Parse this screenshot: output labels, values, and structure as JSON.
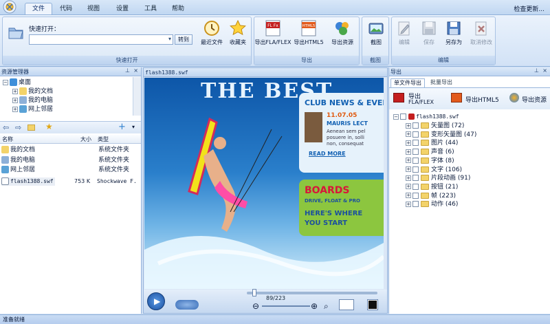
{
  "tabs": [
    "文件",
    "代码",
    "视图",
    "设置",
    "工具",
    "帮助"
  ],
  "check_update": "检查更新...",
  "ribbon": {
    "quick_open": {
      "label": "快速打开：",
      "button": "转到",
      "group": "快速打开"
    },
    "recent": "最近文件",
    "favorites": "收藏夹",
    "export_group": "导出",
    "export_fla": "导出FLA/FLEX",
    "export_html5": "导出HTML5",
    "export_res": "导出资源",
    "capture": "截图",
    "capture_group": "截图",
    "edit": "编辑",
    "save": "保存",
    "save_as": "另存为",
    "cancel": "取消修改",
    "edit_group": "编辑",
    "icon_tags": {
      "fla": "FL Fx",
      "html5": "HTML5"
    }
  },
  "explorer": {
    "title": "资源管理器",
    "tree": [
      "桌面",
      "我的文档",
      "我的电脑",
      "网上邻居"
    ],
    "cols": {
      "name": "名称",
      "size": "大小",
      "type": "类型"
    },
    "files": [
      {
        "name": "我的文档",
        "size": "",
        "type": "系统文件夹"
      },
      {
        "name": "我的电脑",
        "size": "",
        "type": "系统文件夹"
      },
      {
        "name": "网上邻居",
        "size": "",
        "type": "系统文件夹"
      },
      {
        "name": "flash1388.swf",
        "size": "753 K",
        "type": "Shockwave F."
      }
    ]
  },
  "preview": {
    "title": "flash1388.swf",
    "frame": "89/223",
    "art": {
      "best": "THE BEST",
      "club": "CLUB NEWS & EVENTS",
      "date": "11.07.05",
      "lect": "MAURIS LECT",
      "txt1": "Aenean sem pel",
      "txt2": "posuere in, solli",
      "txt3": "non, consequat",
      "more": "READ MORE",
      "boards": "BOARDS",
      "drive": "DRIVE, FLOAT & PRO",
      "here": "HERE'S WHERE",
      "start": "YOU START"
    }
  },
  "export": {
    "title": "导出",
    "tabs": [
      "单文件导出",
      "批量导出"
    ],
    "btn_fla": "导出\nFLA/FLEX",
    "btn_fla1": "导出",
    "btn_fla2": "FLA/FLEX",
    "btn_html5": "导出HTML5",
    "btn_res": "导出资源",
    "root": "flash1388.swf",
    "items": [
      "矢量图 (72)",
      "变形矢量图 (47)",
      "图片 (44)",
      "声音 (6)",
      "字体 (8)",
      "文字 (106)",
      "片段动画 (91)",
      "按钮 (21)",
      "帧 (223)",
      "动作 (46)"
    ]
  },
  "status": "准备就绪"
}
